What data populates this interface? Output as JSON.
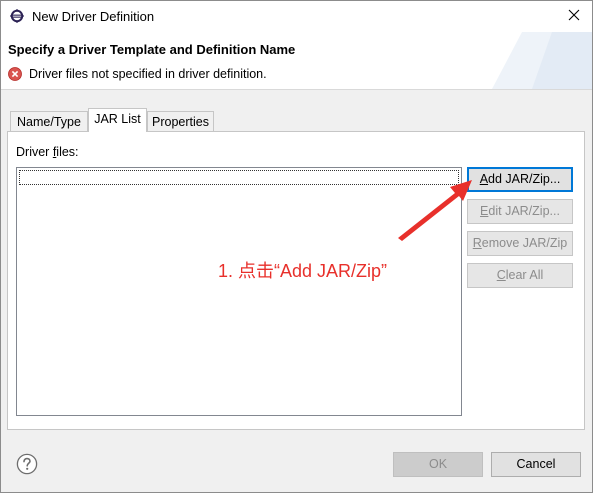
{
  "window": {
    "title": "New Driver Definition",
    "app_icon": "eclipse-icon",
    "close_icon": "close-icon"
  },
  "header": {
    "title": "Specify a Driver Template and Definition Name",
    "message": "Driver files not specified in driver definition.",
    "message_icon": "error-icon"
  },
  "tabs": [
    {
      "label": "Name/Type",
      "active": false
    },
    {
      "label": "JAR List",
      "active": true
    },
    {
      "label": "Properties",
      "active": false
    }
  ],
  "jar_list": {
    "label_prefix": "Driver ",
    "label_mnemonic": "f",
    "label_suffix": "iles:",
    "items": []
  },
  "side_buttons": [
    {
      "mnemonic": "A",
      "rest": "dd JAR/Zip...",
      "enabled": true
    },
    {
      "mnemonic": "E",
      "rest": "dit JAR/Zip...",
      "enabled": false
    },
    {
      "mnemonic": "R",
      "rest": "emove JAR/Zip",
      "enabled": false
    },
    {
      "mnemonic": "C",
      "rest": "lear All",
      "enabled": false
    }
  ],
  "annotation": {
    "text": "1. 点击“Add JAR/Zip”",
    "color": "#e8302b"
  },
  "footer": {
    "help_icon": "help-icon",
    "ok_label": "OK",
    "ok_enabled": false,
    "cancel_label": "Cancel"
  }
}
